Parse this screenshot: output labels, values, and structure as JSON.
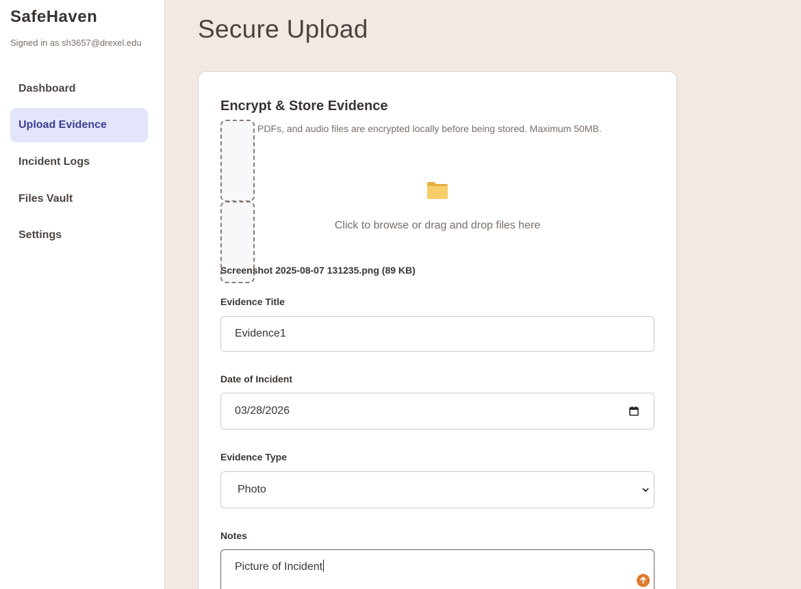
{
  "sidebar": {
    "brand": "SafeHaven",
    "signed_in": "Signed in as sh3657@drexel.edu",
    "items": [
      {
        "label": "Dashboard"
      },
      {
        "label": "Upload Evidence"
      },
      {
        "label": "Incident Logs"
      },
      {
        "label": "Files Vault"
      },
      {
        "label": "Settings"
      }
    ],
    "active_item": "Upload Evidence"
  },
  "page": {
    "title": "Secure Upload"
  },
  "card": {
    "title": "Encrypt & Store Evidence",
    "description": "PDFs, and audio files are encrypted locally before being stored. Maximum 50MB.",
    "dropzone_icon": "folder-icon",
    "dropzone_text": "Click to browse or drag and drop files here",
    "selected_file": "Screenshot 2025-08-07 131235.png (89 KB)"
  },
  "form": {
    "title_label": "Evidence Title",
    "title_value": "Evidence1",
    "date_label": "Date of Incident",
    "date_value": "03/28/2026",
    "type_label": "Evidence Type",
    "type_value": "Photo",
    "notes_label": "Notes",
    "notes_value": "Picture of Incident"
  },
  "colors": {
    "background": "#f2e9e2",
    "active_nav_bg": "#e3e6fb",
    "active_nav_text": "#3d3d8f",
    "accent_orange": "#e07a2e",
    "folder_yellow": "#f5c55a"
  }
}
